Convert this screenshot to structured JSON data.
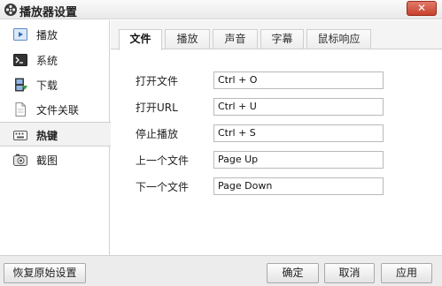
{
  "window": {
    "title": "播放器设置",
    "close_label": "✕"
  },
  "sidebar": {
    "items": [
      {
        "label": "播放",
        "icon": "play-icon"
      },
      {
        "label": "系统",
        "icon": "terminal-icon"
      },
      {
        "label": "下载",
        "icon": "film-download-icon"
      },
      {
        "label": "文件关联",
        "icon": "document-icon"
      },
      {
        "label": "热键",
        "icon": "keyboard-icon",
        "selected": true
      },
      {
        "label": "截图",
        "icon": "camera-icon"
      }
    ]
  },
  "tabs": [
    {
      "label": "文件",
      "selected": true
    },
    {
      "label": "播放"
    },
    {
      "label": "声音"
    },
    {
      "label": "字幕"
    },
    {
      "label": "鼠标响应"
    }
  ],
  "hotkeys": [
    {
      "label": "打开文件",
      "value": "Ctrl + O"
    },
    {
      "label": "打开URL",
      "value": "Ctrl + U"
    },
    {
      "label": "停止播放",
      "value": "Ctrl + S"
    },
    {
      "label": "上一个文件",
      "value": "Page Up"
    },
    {
      "label": "下一个文件",
      "value": "Page Down"
    }
  ],
  "buttons": {
    "restore_label": "恢复原始设置",
    "ok_label": "确定",
    "cancel_label": "取消",
    "apply_label": "应用"
  },
  "colors": {
    "close_button": "#c6402c",
    "active_row": "#f2f2f2"
  }
}
